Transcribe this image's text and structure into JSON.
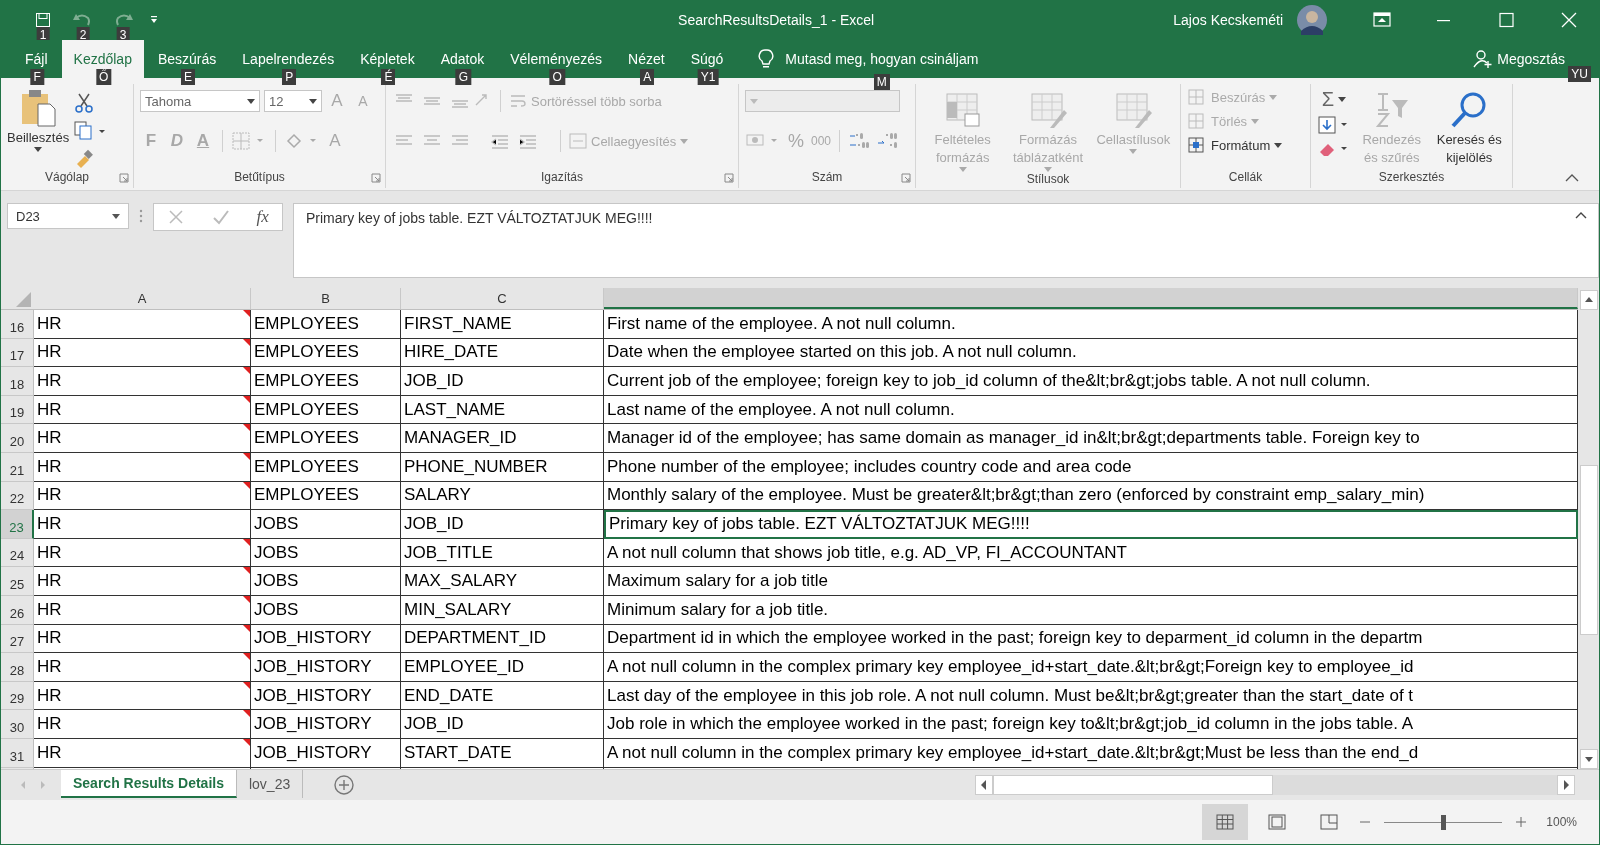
{
  "window": {
    "title": "SearchResultsDetails_1  -  Excel",
    "user": "Lajos Kecskeméti"
  },
  "quick_access": [
    {
      "kind": "save",
      "keytip": "1",
      "disabled": false
    },
    {
      "kind": "undo",
      "keytip": "2",
      "disabled": true
    },
    {
      "kind": "redo",
      "keytip": "3",
      "disabled": true
    }
  ],
  "tabs": [
    {
      "label": "Fájl",
      "keytip": "F",
      "selected": false
    },
    {
      "label": "Kezdőlap",
      "keytip": "Ő",
      "selected": true
    },
    {
      "label": "Beszúrás",
      "keytip": "E",
      "selected": false
    },
    {
      "label": "Lapelrendezés",
      "keytip": "P",
      "selected": false
    },
    {
      "label": "Képletek",
      "keytip": "É",
      "selected": false
    },
    {
      "label": "Adatok",
      "keytip": "G",
      "selected": false
    },
    {
      "label": "Véleményezés",
      "keytip": "O",
      "selected": false
    },
    {
      "label": "Nézet",
      "keytip": "A",
      "selected": false
    },
    {
      "label": "Súgó",
      "keytip": "Y1",
      "selected": false
    }
  ],
  "tell_me": {
    "text": "Mutasd meg, hogyan csináljam",
    "keytip": "M"
  },
  "share": {
    "label": "Megosztás",
    "keytip": "YU"
  },
  "ribbon": {
    "groups": [
      {
        "kind": "clipboard",
        "label": "Vágólap",
        "paste": "Beillesztés"
      },
      {
        "kind": "font",
        "label": "Betűtípus",
        "font_name": "Tahoma",
        "font_size": "12",
        "grow": "A",
        "shrink": "A",
        "bold": "F",
        "italic": "D",
        "underline": "A",
        "font_color": "A",
        "disabled": true
      },
      {
        "kind": "alignment",
        "label": "Igazítás",
        "wrap": "Sortöréssel több sorba",
        "merge": "Cellaegyesítés",
        "disabled": true
      },
      {
        "kind": "number",
        "label": "Szám",
        "percent": "%",
        "thousands": "000",
        "disabled": true
      },
      {
        "kind": "styles",
        "label": "Stílusok",
        "items": [
          {
            "kind": "conditional",
            "lines": [
              "Feltételes",
              "formázás"
            ],
            "disabled": true
          },
          {
            "kind": "table",
            "lines": [
              "Formázás",
              "táblázatként"
            ],
            "disabled": true
          },
          {
            "kind": "cellstyles",
            "lines": [
              "Cellastílusok"
            ],
            "disabled": true
          }
        ]
      },
      {
        "kind": "cells",
        "label": "Cellák",
        "items": [
          {
            "kind": "insert",
            "label": "Beszúrás",
            "disabled": true
          },
          {
            "kind": "delete",
            "label": "Törlés",
            "disabled": true
          },
          {
            "kind": "format",
            "label": "Formátum",
            "disabled": false
          }
        ]
      },
      {
        "kind": "editing",
        "label": "Szerkesztés",
        "autosum": "Σ",
        "sort": {
          "lines": [
            "Rendezés",
            "és szűrés"
          ],
          "disabled": true
        },
        "find": {
          "lines": [
            "Keresés és",
            "kijelölés"
          ],
          "disabled": false
        }
      }
    ]
  },
  "formula_bar": {
    "name_box": "D23",
    "fx": "fx",
    "formula": "Primary key of jobs table. EZT VÁLTOZTATJUK MEG!!!!"
  },
  "columns": [
    {
      "label": "A",
      "selected": false
    },
    {
      "label": "B",
      "selected": false
    },
    {
      "label": "C",
      "selected": false
    },
    {
      "selected": true
    }
  ],
  "rows": [
    {
      "num": "16",
      "selected": false,
      "comment": true,
      "cells": [
        "HR",
        "EMPLOYEES",
        "FIRST_NAME",
        "First name of the employee. A not null column."
      ]
    },
    {
      "num": "17",
      "selected": false,
      "comment": true,
      "cells": [
        "HR",
        "EMPLOYEES",
        "HIRE_DATE",
        "Date when the employee started on this job. A not null column."
      ]
    },
    {
      "num": "18",
      "selected": false,
      "comment": true,
      "cells": [
        "HR",
        "EMPLOYEES",
        "JOB_ID",
        "Current job of the employee; foreign key to job_id column of the&lt;br&gt;jobs table. A not null column."
      ]
    },
    {
      "num": "19",
      "selected": false,
      "comment": true,
      "cells": [
        "HR",
        "EMPLOYEES",
        "LAST_NAME",
        "Last name of the employee. A not null column."
      ]
    },
    {
      "num": "20",
      "selected": false,
      "comment": true,
      "cells": [
        "HR",
        "EMPLOYEES",
        "MANAGER_ID",
        "Manager id of the employee; has same domain as manager_id in&lt;br&gt;departments table. Foreign key to"
      ]
    },
    {
      "num": "21",
      "selected": false,
      "comment": true,
      "cells": [
        "HR",
        "EMPLOYEES",
        "PHONE_NUMBER",
        "Phone number of the employee; includes country code and area code"
      ]
    },
    {
      "num": "22",
      "selected": false,
      "comment": true,
      "cells": [
        "HR",
        "EMPLOYEES",
        "SALARY",
        "Monthly salary of the employee. Must be greater&lt;br&gt;than zero (enforced by constraint emp_salary_min)"
      ]
    },
    {
      "num": "23",
      "selected": true,
      "comment": false,
      "cells": [
        "HR",
        "JOBS",
        "JOB_ID",
        "Primary key of jobs table. EZT VÁLTOZTATJUK MEG!!!!"
      ]
    },
    {
      "num": "24",
      "selected": false,
      "comment": true,
      "cells": [
        "HR",
        "JOBS",
        "JOB_TITLE",
        "A not null column that shows job title, e.g. AD_VP, FI_ACCOUNTANT"
      ]
    },
    {
      "num": "25",
      "selected": false,
      "comment": true,
      "cells": [
        "HR",
        "JOBS",
        "MAX_SALARY",
        "Maximum salary for a job title"
      ]
    },
    {
      "num": "26",
      "selected": false,
      "comment": true,
      "cells": [
        "HR",
        "JOBS",
        "MIN_SALARY",
        "Minimum salary for a job title."
      ]
    },
    {
      "num": "27",
      "selected": false,
      "comment": true,
      "cells": [
        "HR",
        "JOB_HISTORY",
        "DEPARTMENT_ID",
        "Department id in which the employee worked in the past; foreign key to deparment_id column in the departm"
      ]
    },
    {
      "num": "28",
      "selected": false,
      "comment": true,
      "cells": [
        "HR",
        "JOB_HISTORY",
        "EMPLOYEE_ID",
        "A not null column in the complex primary key employee_id+start_date.&lt;br&gt;Foreign key to employee_id"
      ]
    },
    {
      "num": "29",
      "selected": false,
      "comment": true,
      "cells": [
        "HR",
        "JOB_HISTORY",
        "END_DATE",
        "Last day of the employee in this job role. A not null column. Must be&lt;br&gt;greater than the start_date of t"
      ]
    },
    {
      "num": "30",
      "selected": false,
      "comment": true,
      "cells": [
        "HR",
        "JOB_HISTORY",
        "JOB_ID",
        "Job role in which the employee worked in the past; foreign key to&lt;br&gt;job_id column in the jobs table. A"
      ]
    },
    {
      "num": "31",
      "selected": false,
      "comment": true,
      "cells": [
        "HR",
        "JOB_HISTORY",
        "START_DATE",
        "A not null column in the complex primary key employee_id+start_date.&lt;br&gt;Must be less than the end_d"
      ]
    }
  ],
  "sheet_tabs": [
    {
      "label": "Search Results Details",
      "selected": true
    },
    {
      "label": "lov_23",
      "selected": false
    }
  ],
  "status_bar": {
    "zoom": "100%",
    "zoom_slider": {
      "level": 0.5
    },
    "views": [
      {
        "kind": "normal",
        "selected": true
      },
      {
        "kind": "page_layout",
        "selected": false
      },
      {
        "kind": "page_break",
        "selected": false
      }
    ]
  }
}
